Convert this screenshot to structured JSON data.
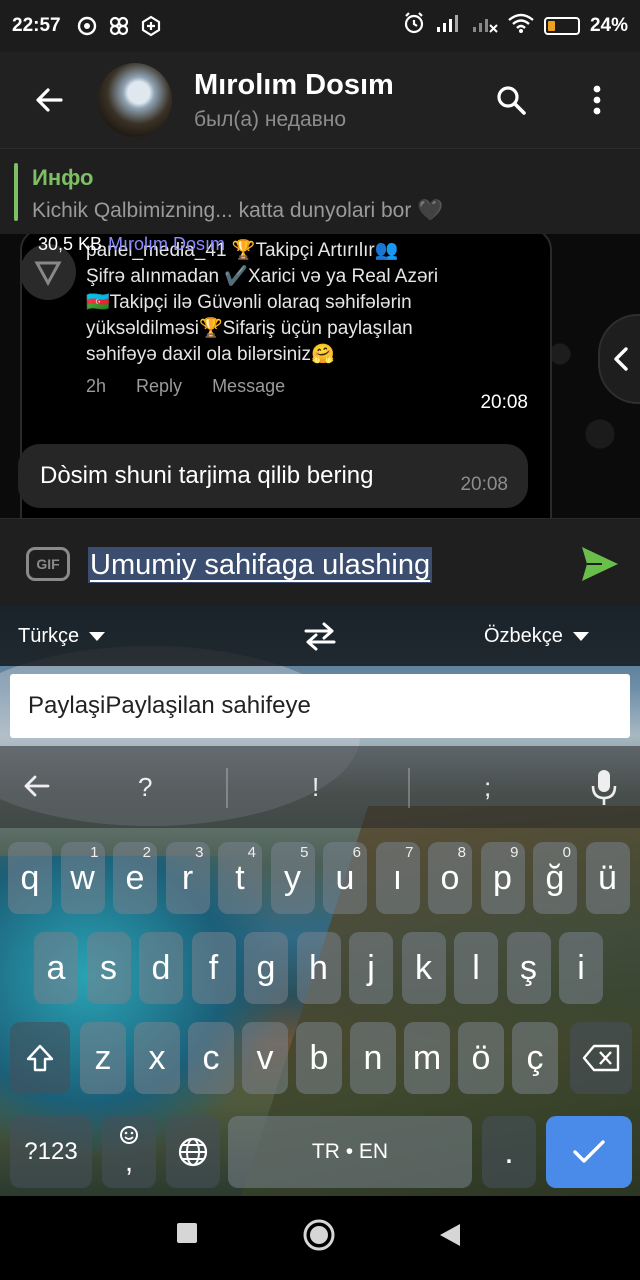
{
  "status_bar": {
    "time": "22:57",
    "battery_pct": "24%",
    "battery_level": 0.24
  },
  "header": {
    "contact_name": "Mırolım Dosım",
    "status": "был(а) недавно"
  },
  "pinned": {
    "title": "Инфо",
    "text": "Kichik Qalbimizning... katta dunyolari bor 🖤"
  },
  "media_message": {
    "file_size": "30,5 KB",
    "sender": "Mırolım Dosım",
    "caption_lines": [
      "panel_media_41 🏆Takipçi Artırılır👥",
      "Şifrə alınmadan ✔️Xarici və ya Real Azəri",
      "🇦🇿Takipçi ilə Güvənli olaraq səhifələrin",
      "yüksəldilməsi🏆Sifariş üçün paylaşılan",
      "səhifəyə daxil ola bilərsiniz🤗"
    ],
    "actions": {
      "age": "2h",
      "reply": "Reply",
      "message": "Message"
    },
    "time": "20:08"
  },
  "text_message": {
    "text": "Dòsim shuni tarjima qilib bering",
    "time": "20:08"
  },
  "compose": {
    "gif_label": "GIF",
    "input_text": "Umumiy sahifaga ulashing"
  },
  "translator": {
    "source_lang": "Türkçe",
    "target_lang": "Özbekçe",
    "input_text": "PaylaşiPaylaşilan sahifeye"
  },
  "suggestions": [
    "?",
    "!",
    ";"
  ],
  "keyboard": {
    "row1": [
      {
        "k": "q",
        "h": ""
      },
      {
        "k": "w",
        "h": "1"
      },
      {
        "k": "e",
        "h": "2"
      },
      {
        "k": "r",
        "h": "3"
      },
      {
        "k": "t",
        "h": "4"
      },
      {
        "k": "y",
        "h": "5"
      },
      {
        "k": "u",
        "h": "6"
      },
      {
        "k": "ı",
        "h": "7"
      },
      {
        "k": "o",
        "h": "8"
      },
      {
        "k": "p",
        "h": "9"
      },
      {
        "k": "ğ",
        "h": "0"
      },
      {
        "k": "ü",
        "h": ""
      }
    ],
    "row2": [
      "a",
      "s",
      "d",
      "f",
      "g",
      "h",
      "j",
      "k",
      "l",
      "ş",
      "i"
    ],
    "row3": [
      "z",
      "x",
      "c",
      "v",
      "b",
      "n",
      "m",
      "ö",
      "ç"
    ],
    "symbols_key": "?123",
    "comma_key": ",",
    "space_label": "TR • EN",
    "period_key": "."
  },
  "colors": {
    "accent_green": "#7cc063",
    "send_green": "#6abe4a",
    "enter_blue": "#4a8ae8",
    "sender_purple": "#8b8bff"
  }
}
